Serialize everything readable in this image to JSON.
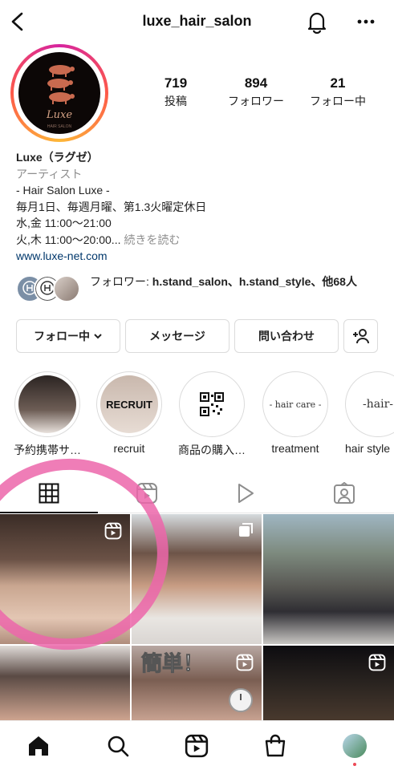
{
  "header": {
    "title": "luxe_hair_salon"
  },
  "avatar": {
    "logo_text": "Luxe",
    "sub_text": "HAIR SALON"
  },
  "stats": [
    {
      "num": "719",
      "label": "投稿"
    },
    {
      "num": "894",
      "label": "フォロワー"
    },
    {
      "num": "21",
      "label": "フォロー中"
    }
  ],
  "bio": {
    "name": "Luxe（ラグゼ）",
    "category": "アーティスト",
    "line1": "- Hair Salon Luxe -",
    "line2": "毎月1日、毎週月曜、第1.3火曜定休日",
    "line3": "水,金 11:00～21:00",
    "line4": "火,木 11:00～20:00...",
    "more": "続きを読む",
    "url": "www.luxe-net.com"
  },
  "followers": {
    "prefix": "フォロワー: ",
    "names": "h.stand_salon、h.stand_style",
    "suffix": "、他68人",
    "avatar_text": "H.STAND"
  },
  "buttons": {
    "following": "フォロー中",
    "message": "メッセージ",
    "contact": "問い合わせ"
  },
  "highlights": [
    {
      "label": "予約携帯サ…",
      "inner": ""
    },
    {
      "label": "recruit",
      "inner": "RECRUIT"
    },
    {
      "label": "商品の購入…",
      "inner": ""
    },
    {
      "label": "treatment",
      "inner": "- hair care -"
    },
    {
      "label": "hair style",
      "inner": "-hair-"
    }
  ],
  "grid_text": {
    "overlay": "簡単！"
  },
  "colors": {
    "link": "#00376b",
    "secondary": "#8e8e8e",
    "annotation": "#ec66aa",
    "notify": "#ed4956"
  }
}
